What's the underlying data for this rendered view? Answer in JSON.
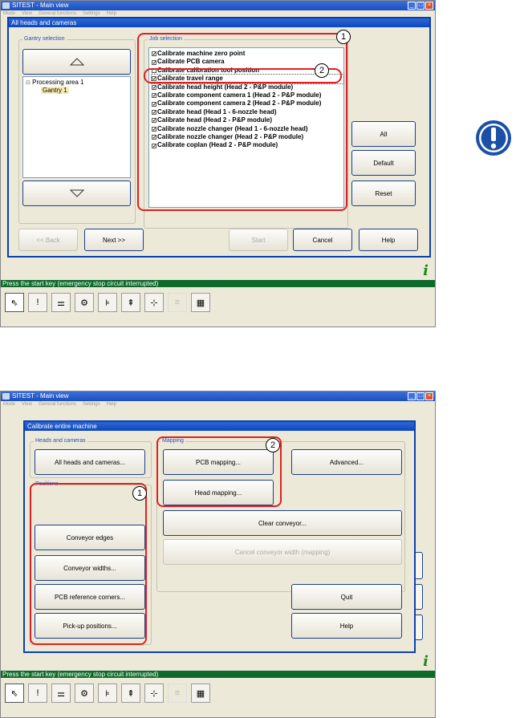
{
  "app": {
    "window_title": "SITEST - Main view",
    "menu": [
      "Mode",
      "View",
      "General functions",
      "Settings",
      "Help"
    ],
    "status_text": "Press the start key (emergency stop circuit interrupted)",
    "toolbar_icons": [
      "pointer-icon",
      "warning-icon",
      "conveyor-icon",
      "gear-icon",
      "feeder-icon",
      "nozzle-icon",
      "axis-icon",
      "list-icon",
      "grid-icon"
    ]
  },
  "screen1": {
    "dialog_title": "All heads and cameras",
    "gantry_group": "Gantry selection",
    "tree": {
      "root": "Processing area 1",
      "child": "Gantry 1",
      "expander": "⊟"
    },
    "job_group": "Job selection",
    "jobs": [
      {
        "label": "Calibrate machine zero point",
        "checked": true
      },
      {
        "label": "Calibrate PCB camera",
        "checked": true
      },
      {
        "label": "Calibrate calibration tool position",
        "checked": false
      },
      {
        "label": "Calibrate travel range",
        "checked": true
      },
      {
        "label": "Calibrate head height (Head 2 - P&P module)",
        "checked": true
      },
      {
        "label": "Calibrate component camera 1 (Head 2 - P&P module)",
        "checked": true
      },
      {
        "label": "Calibrate component camera 2 (Head 2 - P&P module)",
        "checked": true
      },
      {
        "label": "Calibrate head (Head 1 - 6-nozzle head)",
        "checked": true
      },
      {
        "label": "Calibrate head (Head 2 - P&P module)",
        "checked": true
      },
      {
        "label": "Calibrate nozzle changer (Head 1 - 6-nozzle head)",
        "checked": true
      },
      {
        "label": "Calibrate nozzle changer (Head 2 - P&P module)",
        "checked": true
      },
      {
        "label": "Calibrate coplan (Head 2 - P&P module)",
        "checked": true
      }
    ],
    "buttons": {
      "all": "All",
      "default": "Default",
      "reset": "Reset",
      "back": "<< Back",
      "next": "Next >>",
      "start": "Start",
      "cancel": "Cancel",
      "help": "Help"
    },
    "callouts": [
      "1",
      "2"
    ]
  },
  "screen2": {
    "dialog_title": "Calibrate entire machine",
    "heads_group": "Heads and cameras",
    "mapping_group": "Mapping",
    "positions_group": "Positions",
    "buttons": {
      "all_heads": "All heads and cameras...",
      "pcb_mapping": "PCB mapping...",
      "head_mapping": "Head mapping...",
      "advanced": "Advanced...",
      "clear_conveyor": "Clear conveyor...",
      "cancel_conveyor_width": "Cancel conveyor width (mapping)",
      "conveyor_edges": "Conveyor edges",
      "conveyor_widths": "Conveyor widths...",
      "pcb_reference": "PCB reference corners...",
      "pickup_positions": "Pick-up positions...",
      "quit": "Quit",
      "help": "Help"
    },
    "callouts": [
      "1",
      "2"
    ]
  }
}
